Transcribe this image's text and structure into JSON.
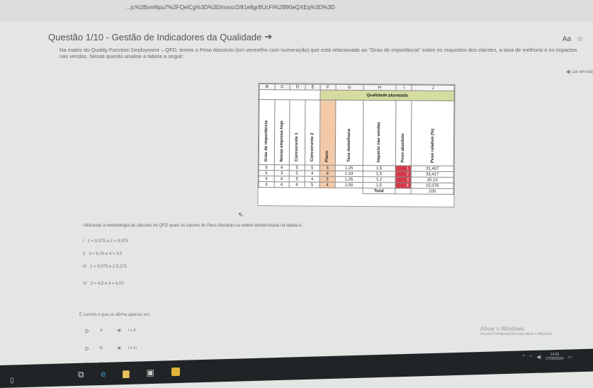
{
  "browser": {
    "url": "...jc%2BvmNpu7%2FQelCg%3D%3D/novo/2/81e8grBUcFI%2B90eQXEq%3D%3D",
    "icons": [
      "reading-mode-icon",
      "favorite-star-icon"
    ],
    "read_aloud": "Ler em voz"
  },
  "question": {
    "title": "Questão 1/10 - Gestão de Indicadores da Qualidade",
    "arrow": "➔",
    "intro": "Na matriz do Quality Function Deployment – QFD, temos o Peso Absoluto (em vermelho com numeração) que está relacionado ao \"Grau de importância\" sobre os requisitos dos clientes, a taxa de melhoria e os impactos nas vendas. Nesse quesito analise a tabela a seguir:",
    "ask": "Utilizando a metodologia de cálculos do QFD quais os valores do Peso Absoluto na ordem demonstrada na tabela é:",
    "statements": [
      {
        "label": "I",
        "text": "1 = 9,375 e 2 = 9,975"
      },
      {
        "label": "II",
        "text": "3 = 6,00 e 4 = 4,5"
      },
      {
        "label": "III",
        "text": "1 = 9,975 e 2 9,375"
      },
      {
        "label": "IV",
        "text": "3 = 4,5 e 4 = 6,00"
      }
    ],
    "prompt": "É correto o que se afirma apenas em:",
    "options": [
      {
        "letter": "A",
        "text": "I e II"
      },
      {
        "letter": "B",
        "text": "I e IV"
      },
      {
        "letter": "C",
        "text": "II e III"
      }
    ]
  },
  "qfd_table": {
    "col_letters": [
      "B",
      "C",
      "D",
      "E",
      "F",
      "G",
      "H",
      "I",
      "J"
    ],
    "group_header": "Qualidade planejada",
    "headers": [
      "Grau de importância",
      "Nossa empresa hoje",
      "Concorrente 1",
      "Concorrente 2",
      "Plano",
      "Taxa demelhoria",
      "Impacto nas vendas",
      "Peso absoluto",
      "Peso relativo (%)"
    ],
    "rows": [
      [
        "5",
        "4",
        "5",
        "5",
        "5",
        "1,25",
        "1,5",
        "1",
        "31,407"
      ],
      [
        "5",
        "3",
        "5",
        "4",
        "4",
        "1,33",
        "1,5",
        "2",
        "33,417"
      ],
      [
        "4",
        "4",
        "5",
        "4",
        "5",
        "1,25",
        "1,2",
        "3",
        "20,10"
      ],
      [
        "3",
        "4",
        "4",
        "5",
        "4",
        "1,00",
        "1,5",
        "4",
        "15,076"
      ]
    ],
    "total_label": "Total",
    "total_value": "100"
  },
  "windows": {
    "activate_title": "Ativar o Windows",
    "activate_sub": "Acesse Configurações para ativar o Windows.",
    "time": "14:25",
    "date": "27/05/2024"
  },
  "colors": {
    "plano": "#f3c9a8",
    "peso_absoluto": "#d63a4a",
    "group_header": "#d6dca0",
    "taskbar": "#202426"
  }
}
